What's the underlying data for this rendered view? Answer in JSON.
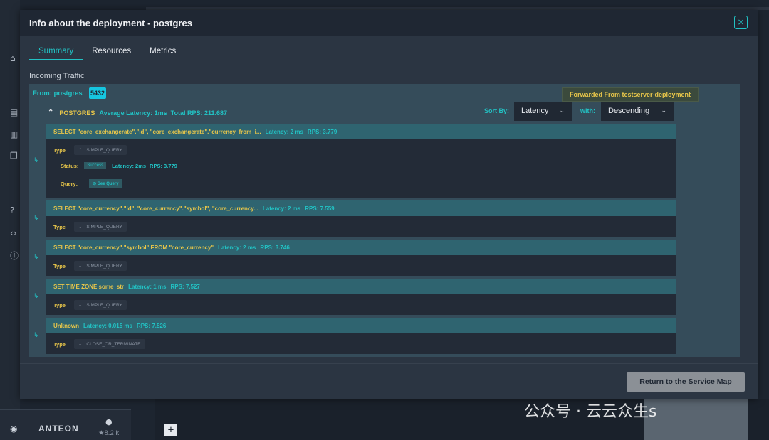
{
  "modal": {
    "title": "Info about the deployment - postgres",
    "close_icon": "×",
    "tabs": [
      {
        "label": "Summary",
        "active": true
      },
      {
        "label": "Resources",
        "active": false
      },
      {
        "label": "Metrics",
        "active": false
      }
    ],
    "section_title": "Incoming Traffic",
    "from_label": "From: postgres",
    "port": "5432",
    "forwarded": "Forwarded From testserver-deployment",
    "group": {
      "name": "POSTGRES",
      "avg_latency": "Average Latency: 1ms",
      "total_rps": "Total RPS: 211.687"
    },
    "sort": {
      "sort_by_label": "Sort By:",
      "sort_by_value": "Latency",
      "with_label": "with:",
      "with_value": "Descending"
    },
    "queries": [
      {
        "name": "SELECT \"core_exchangerate\".\"id\", \"core_exchangerate\".\"currency_from_i...",
        "latency": "Latency: 2 ms",
        "rps": "RPS: 3.779",
        "type_label": "Type",
        "type_value": "SIMPLE_QUERY",
        "expanded": true,
        "status_label": "Status:",
        "status_value": "Success",
        "status_latency": "Latency: 2ms",
        "status_rps": "RPS: 3.779",
        "query_label": "Query:",
        "see_query": "See Query"
      },
      {
        "name": "SELECT \"core_currency\".\"id\", \"core_currency\".\"symbol\", \"core_currency...",
        "latency": "Latency: 2 ms",
        "rps": "RPS: 7.559",
        "type_label": "Type",
        "type_value": "SIMPLE_QUERY"
      },
      {
        "name": "SELECT \"core_currency\".\"symbol\" FROM \"core_currency\"",
        "latency": "Latency: 2 ms",
        "rps": "RPS: 3.746",
        "type_label": "Type",
        "type_value": "SIMPLE_QUERY"
      },
      {
        "name": "SET TIME ZONE some_str",
        "latency": "Latency: 1 ms",
        "rps": "RPS: 7.527",
        "type_label": "Type",
        "type_value": "SIMPLE_QUERY"
      },
      {
        "name": "Unknown",
        "latency": "Latency: 0.015 ms",
        "rps": "RPS: 7.526",
        "type_label": "Type",
        "type_value": "CLOSE_OR_TERMINATE"
      }
    ],
    "return_button": "Return to the Service Map"
  },
  "footer": {
    "brand": "ANTEON",
    "stars": "★8.2 k",
    "watermark": "公众号 · 云云众生s"
  },
  "colors": {
    "accent": "#22c2c4",
    "highlight": "#e8c64a"
  }
}
